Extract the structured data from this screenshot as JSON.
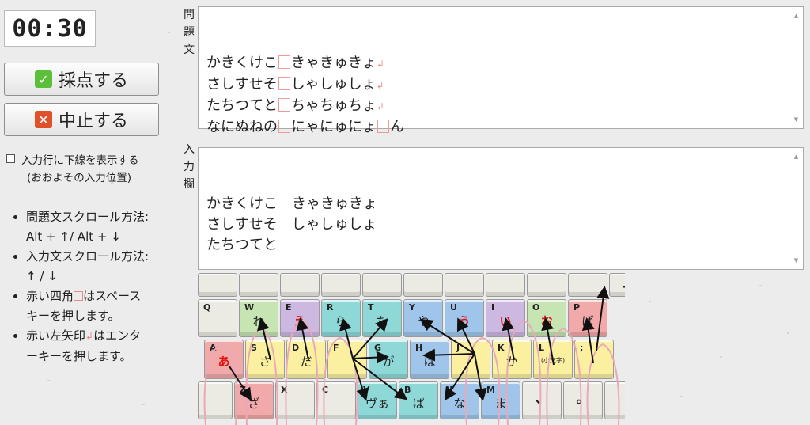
{
  "timer": "00:30",
  "buttons": {
    "score": "採点する",
    "stop": "中止する"
  },
  "underline_option": {
    "label": "入力行に下線を表示する",
    "sub": "(おおよその入力位置)",
    "checked": false
  },
  "tips": {
    "t1a": "問題文スクロール方法:",
    "t1b": "Alt + ↑/ Alt + ↓",
    "t2a": "入力文スクロール方法:",
    "t2b": "↑ / ↓",
    "t3a": "赤い四角",
    "t3b": "はスペース",
    "t3c": "キーを押します。",
    "t4a": "赤い左矢印",
    "t4b": "はエンタ",
    "t4c": "ーキーを押します。"
  },
  "labels": {
    "question": [
      "問",
      "題",
      "文"
    ],
    "input": [
      "入",
      "力",
      "欄"
    ]
  },
  "question_lines": [
    [
      "かきくけこ",
      "きゃきゅきょ"
    ],
    [
      "さしすせそ",
      "しゃしゅしょ"
    ],
    [
      "たちつてと",
      "ちゃちゅちょ"
    ],
    [
      "なにぬねの",
      "にゃにゅにょ",
      "ん"
    ]
  ],
  "question_line_ends": [
    "return",
    "return",
    "return",
    "none"
  ],
  "input_lines": [
    "かきくけこ　きゃきゅきょ",
    "さしすせそ　しゃしゅしょ",
    "たちつてと"
  ],
  "keyboard": {
    "rows": [
      [
        {
          "en": "",
          "kana": ""
        },
        {
          "en": "",
          "kana": ""
        },
        {
          "en": "",
          "kana": ""
        },
        {
          "en": "",
          "kana": ""
        },
        {
          "en": "",
          "kana": ""
        },
        {
          "en": "",
          "kana": ""
        },
        {
          "en": "",
          "kana": ""
        },
        {
          "en": "",
          "kana": ""
        },
        {
          "en": "",
          "kana": ""
        },
        {
          "en": "",
          "kana": ""
        },
        {
          "en": "",
          "kana": "",
          "big": "—"
        }
      ],
      [
        {
          "en": "Q",
          "kana": ""
        },
        {
          "en": "W",
          "kana": "わ"
        },
        {
          "en": "E",
          "kana": "え",
          "red": true
        },
        {
          "en": "R",
          "kana": "ら"
        },
        {
          "en": "T",
          "kana": "た"
        },
        {
          "en": "Y",
          "kana": "や"
        },
        {
          "en": "U",
          "kana": "う",
          "red": true
        },
        {
          "en": "I",
          "kana": "い",
          "red": true
        },
        {
          "en": "O",
          "kana": "お",
          "red": true
        },
        {
          "en": "P",
          "kana": "ぱ"
        }
      ],
      [
        {
          "en": "A",
          "kana": "あ",
          "red": true
        },
        {
          "en": "S",
          "kana": "さ"
        },
        {
          "en": "D",
          "kana": "だ"
        },
        {
          "en": "F",
          "kana": ""
        },
        {
          "en": "G",
          "kana": "が"
        },
        {
          "en": "H",
          "kana": "は"
        },
        {
          "en": "J",
          "kana": ""
        },
        {
          "en": "K",
          "kana": "か"
        },
        {
          "en": "L",
          "kana": "(小文字)",
          "small": true
        },
        {
          "en": ";",
          "kana": ""
        }
      ],
      [
        {
          "en": "",
          "kana": ""
        },
        {
          "en": "Z",
          "kana": "ざ"
        },
        {
          "en": "X",
          "kana": ""
        },
        {
          "en": "C",
          "kana": ""
        },
        {
          "en": "V",
          "kana": "ヴぁ"
        },
        {
          "en": "B",
          "kana": "ば"
        },
        {
          "en": "N",
          "kana": "な"
        },
        {
          "en": "M",
          "kana": "ま"
        },
        {
          "en": "",
          "kana": "",
          "big": "、"
        },
        {
          "en": "",
          "kana": "",
          "big": "。"
        },
        {
          "en": "",
          "kana": ""
        }
      ]
    ],
    "colors": {
      "blank": "#ecebe3",
      "pinky": "#f2a9a9",
      "ring": "#cdb8e2",
      "middle": "#c7e4b3",
      "left_index": "#8fd8d8",
      "right_index": "#9fc6ea",
      "home": "#faf0a0"
    }
  }
}
